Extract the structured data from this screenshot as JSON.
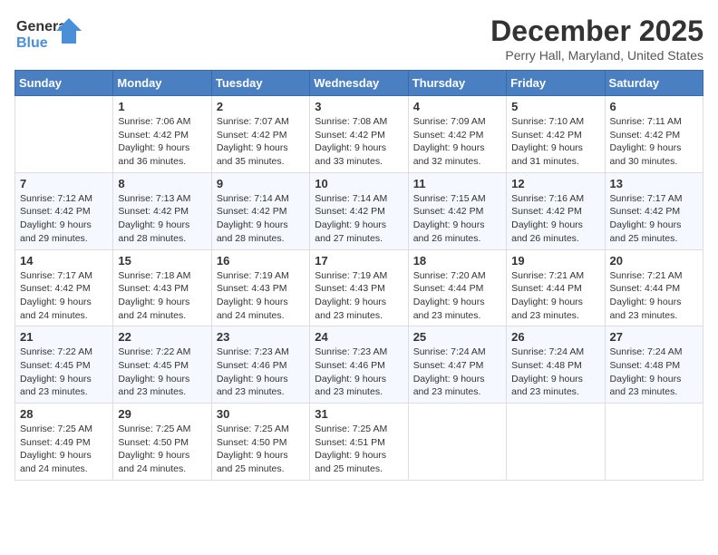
{
  "logo": {
    "line1": "General",
    "line2": "Blue"
  },
  "header": {
    "month_year": "December 2025",
    "location": "Perry Hall, Maryland, United States"
  },
  "days_of_week": [
    "Sunday",
    "Monday",
    "Tuesday",
    "Wednesday",
    "Thursday",
    "Friday",
    "Saturday"
  ],
  "weeks": [
    [
      {
        "day": "",
        "sunrise": "",
        "sunset": "",
        "daylight": ""
      },
      {
        "day": "1",
        "sunrise": "Sunrise: 7:06 AM",
        "sunset": "Sunset: 4:42 PM",
        "daylight": "Daylight: 9 hours and 36 minutes."
      },
      {
        "day": "2",
        "sunrise": "Sunrise: 7:07 AM",
        "sunset": "Sunset: 4:42 PM",
        "daylight": "Daylight: 9 hours and 35 minutes."
      },
      {
        "day": "3",
        "sunrise": "Sunrise: 7:08 AM",
        "sunset": "Sunset: 4:42 PM",
        "daylight": "Daylight: 9 hours and 33 minutes."
      },
      {
        "day": "4",
        "sunrise": "Sunrise: 7:09 AM",
        "sunset": "Sunset: 4:42 PM",
        "daylight": "Daylight: 9 hours and 32 minutes."
      },
      {
        "day": "5",
        "sunrise": "Sunrise: 7:10 AM",
        "sunset": "Sunset: 4:42 PM",
        "daylight": "Daylight: 9 hours and 31 minutes."
      },
      {
        "day": "6",
        "sunrise": "Sunrise: 7:11 AM",
        "sunset": "Sunset: 4:42 PM",
        "daylight": "Daylight: 9 hours and 30 minutes."
      }
    ],
    [
      {
        "day": "7",
        "sunrise": "Sunrise: 7:12 AM",
        "sunset": "Sunset: 4:42 PM",
        "daylight": "Daylight: 9 hours and 29 minutes."
      },
      {
        "day": "8",
        "sunrise": "Sunrise: 7:13 AM",
        "sunset": "Sunset: 4:42 PM",
        "daylight": "Daylight: 9 hours and 28 minutes."
      },
      {
        "day": "9",
        "sunrise": "Sunrise: 7:14 AM",
        "sunset": "Sunset: 4:42 PM",
        "daylight": "Daylight: 9 hours and 28 minutes."
      },
      {
        "day": "10",
        "sunrise": "Sunrise: 7:14 AM",
        "sunset": "Sunset: 4:42 PM",
        "daylight": "Daylight: 9 hours and 27 minutes."
      },
      {
        "day": "11",
        "sunrise": "Sunrise: 7:15 AM",
        "sunset": "Sunset: 4:42 PM",
        "daylight": "Daylight: 9 hours and 26 minutes."
      },
      {
        "day": "12",
        "sunrise": "Sunrise: 7:16 AM",
        "sunset": "Sunset: 4:42 PM",
        "daylight": "Daylight: 9 hours and 26 minutes."
      },
      {
        "day": "13",
        "sunrise": "Sunrise: 7:17 AM",
        "sunset": "Sunset: 4:42 PM",
        "daylight": "Daylight: 9 hours and 25 minutes."
      }
    ],
    [
      {
        "day": "14",
        "sunrise": "Sunrise: 7:17 AM",
        "sunset": "Sunset: 4:42 PM",
        "daylight": "Daylight: 9 hours and 24 minutes."
      },
      {
        "day": "15",
        "sunrise": "Sunrise: 7:18 AM",
        "sunset": "Sunset: 4:43 PM",
        "daylight": "Daylight: 9 hours and 24 minutes."
      },
      {
        "day": "16",
        "sunrise": "Sunrise: 7:19 AM",
        "sunset": "Sunset: 4:43 PM",
        "daylight": "Daylight: 9 hours and 24 minutes."
      },
      {
        "day": "17",
        "sunrise": "Sunrise: 7:19 AM",
        "sunset": "Sunset: 4:43 PM",
        "daylight": "Daylight: 9 hours and 23 minutes."
      },
      {
        "day": "18",
        "sunrise": "Sunrise: 7:20 AM",
        "sunset": "Sunset: 4:44 PM",
        "daylight": "Daylight: 9 hours and 23 minutes."
      },
      {
        "day": "19",
        "sunrise": "Sunrise: 7:21 AM",
        "sunset": "Sunset: 4:44 PM",
        "daylight": "Daylight: 9 hours and 23 minutes."
      },
      {
        "day": "20",
        "sunrise": "Sunrise: 7:21 AM",
        "sunset": "Sunset: 4:44 PM",
        "daylight": "Daylight: 9 hours and 23 minutes."
      }
    ],
    [
      {
        "day": "21",
        "sunrise": "Sunrise: 7:22 AM",
        "sunset": "Sunset: 4:45 PM",
        "daylight": "Daylight: 9 hours and 23 minutes."
      },
      {
        "day": "22",
        "sunrise": "Sunrise: 7:22 AM",
        "sunset": "Sunset: 4:45 PM",
        "daylight": "Daylight: 9 hours and 23 minutes."
      },
      {
        "day": "23",
        "sunrise": "Sunrise: 7:23 AM",
        "sunset": "Sunset: 4:46 PM",
        "daylight": "Daylight: 9 hours and 23 minutes."
      },
      {
        "day": "24",
        "sunrise": "Sunrise: 7:23 AM",
        "sunset": "Sunset: 4:46 PM",
        "daylight": "Daylight: 9 hours and 23 minutes."
      },
      {
        "day": "25",
        "sunrise": "Sunrise: 7:24 AM",
        "sunset": "Sunset: 4:47 PM",
        "daylight": "Daylight: 9 hours and 23 minutes."
      },
      {
        "day": "26",
        "sunrise": "Sunrise: 7:24 AM",
        "sunset": "Sunset: 4:48 PM",
        "daylight": "Daylight: 9 hours and 23 minutes."
      },
      {
        "day": "27",
        "sunrise": "Sunrise: 7:24 AM",
        "sunset": "Sunset: 4:48 PM",
        "daylight": "Daylight: 9 hours and 23 minutes."
      }
    ],
    [
      {
        "day": "28",
        "sunrise": "Sunrise: 7:25 AM",
        "sunset": "Sunset: 4:49 PM",
        "daylight": "Daylight: 9 hours and 24 minutes."
      },
      {
        "day": "29",
        "sunrise": "Sunrise: 7:25 AM",
        "sunset": "Sunset: 4:50 PM",
        "daylight": "Daylight: 9 hours and 24 minutes."
      },
      {
        "day": "30",
        "sunrise": "Sunrise: 7:25 AM",
        "sunset": "Sunset: 4:50 PM",
        "daylight": "Daylight: 9 hours and 25 minutes."
      },
      {
        "day": "31",
        "sunrise": "Sunrise: 7:25 AM",
        "sunset": "Sunset: 4:51 PM",
        "daylight": "Daylight: 9 hours and 25 minutes."
      },
      {
        "day": "",
        "sunrise": "",
        "sunset": "",
        "daylight": ""
      },
      {
        "day": "",
        "sunrise": "",
        "sunset": "",
        "daylight": ""
      },
      {
        "day": "",
        "sunrise": "",
        "sunset": "",
        "daylight": ""
      }
    ]
  ]
}
